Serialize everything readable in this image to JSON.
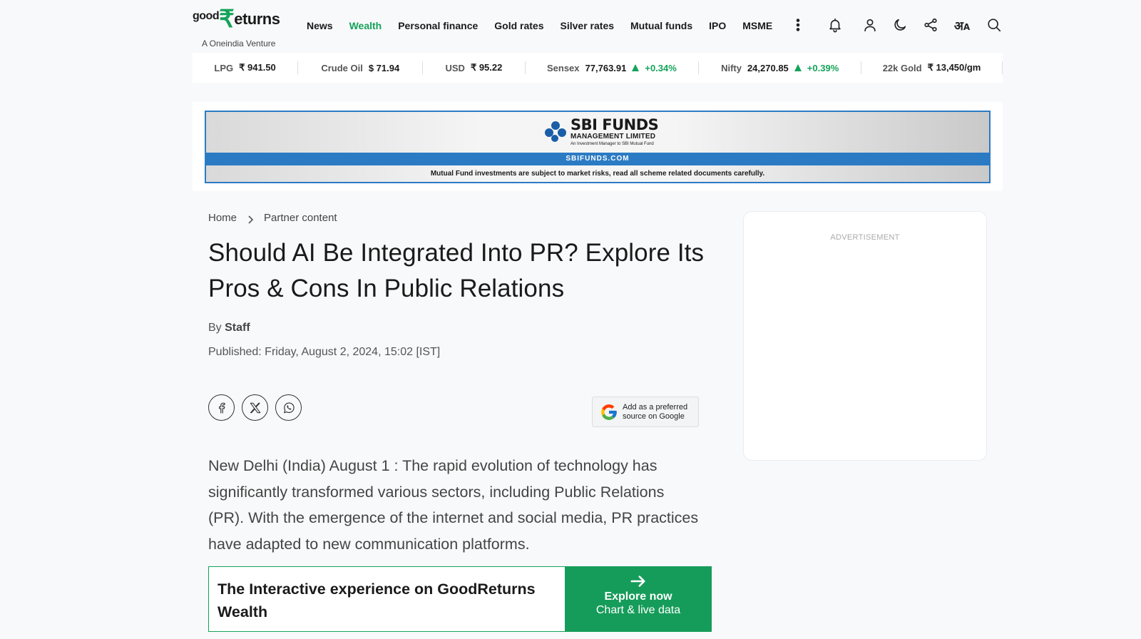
{
  "header": {
    "logo_good": "good",
    "logo_rupee": "₹",
    "logo_rest": "eturns",
    "logo_sub": "A Oneindia Venture",
    "nav": [
      {
        "label": "News",
        "active": false
      },
      {
        "label": "Wealth",
        "active": true
      },
      {
        "label": "Personal finance",
        "active": false
      },
      {
        "label": "Gold rates",
        "active": false
      },
      {
        "label": "Silver rates",
        "active": false
      },
      {
        "label": "Mutual funds",
        "active": false
      },
      {
        "label": "IPO",
        "active": false
      },
      {
        "label": "MSME",
        "active": false
      }
    ],
    "icons": [
      "more-vertical-icon",
      "bell-icon",
      "user-icon",
      "moon-icon",
      "share-icon",
      "language-icon",
      "search-icon"
    ],
    "lang_main": "अ",
    "lang_sub": "A"
  },
  "ticker": [
    {
      "label": "LPG",
      "value": "₹ 941.50",
      "change": ""
    },
    {
      "label": "Crude Oil",
      "value": "$ 71.94",
      "change": ""
    },
    {
      "label": "USD",
      "value": "₹ 95.22",
      "change": ""
    },
    {
      "label": "Sensex",
      "value": "77,763.91",
      "change": "+0.34%"
    },
    {
      "label": "Nifty",
      "value": "24,270.85",
      "change": "+0.39%"
    },
    {
      "label": "22k Gold",
      "value": "₹ 13,450/gm",
      "change": ""
    }
  ],
  "ad_banner": {
    "title": "SBI FUNDS",
    "sub1": "MANAGEMENT LIMITED",
    "sub2": "An Investment Manager to SBI Mutual Fund",
    "strip": "SBIFUNDS.COM",
    "disclaimer": "Mutual Fund investments are subject to market risks, read all scheme related documents carefully."
  },
  "breadcrumb": {
    "home": "Home",
    "section": "Partner content"
  },
  "article": {
    "title": "Should AI Be Integrated Into PR? Explore Its Pros & Cons In Public Relations",
    "by_label": "By",
    "author": "Staff",
    "published": "Published: Friday, August 2, 2024, 15:02 [IST]",
    "body": "New Delhi (India) August 1 : The rapid evolution of technology has significantly transformed various sectors, including Public Relations (PR). With the emergence of the internet and social media, PR practices have adapted to new communication platforms."
  },
  "preferred_source": {
    "line1": "Add as a preferred",
    "line2": "source on Google"
  },
  "cta": {
    "text": "The Interactive experience on GoodReturns Wealth",
    "button_line1": "Explore now",
    "button_line2": "Chart & live data"
  },
  "sidebar": {
    "ad_label": "ADVERTISEMENT"
  },
  "colors": {
    "accent": "#14a35a",
    "ad_blue": "#2b7bc4"
  }
}
